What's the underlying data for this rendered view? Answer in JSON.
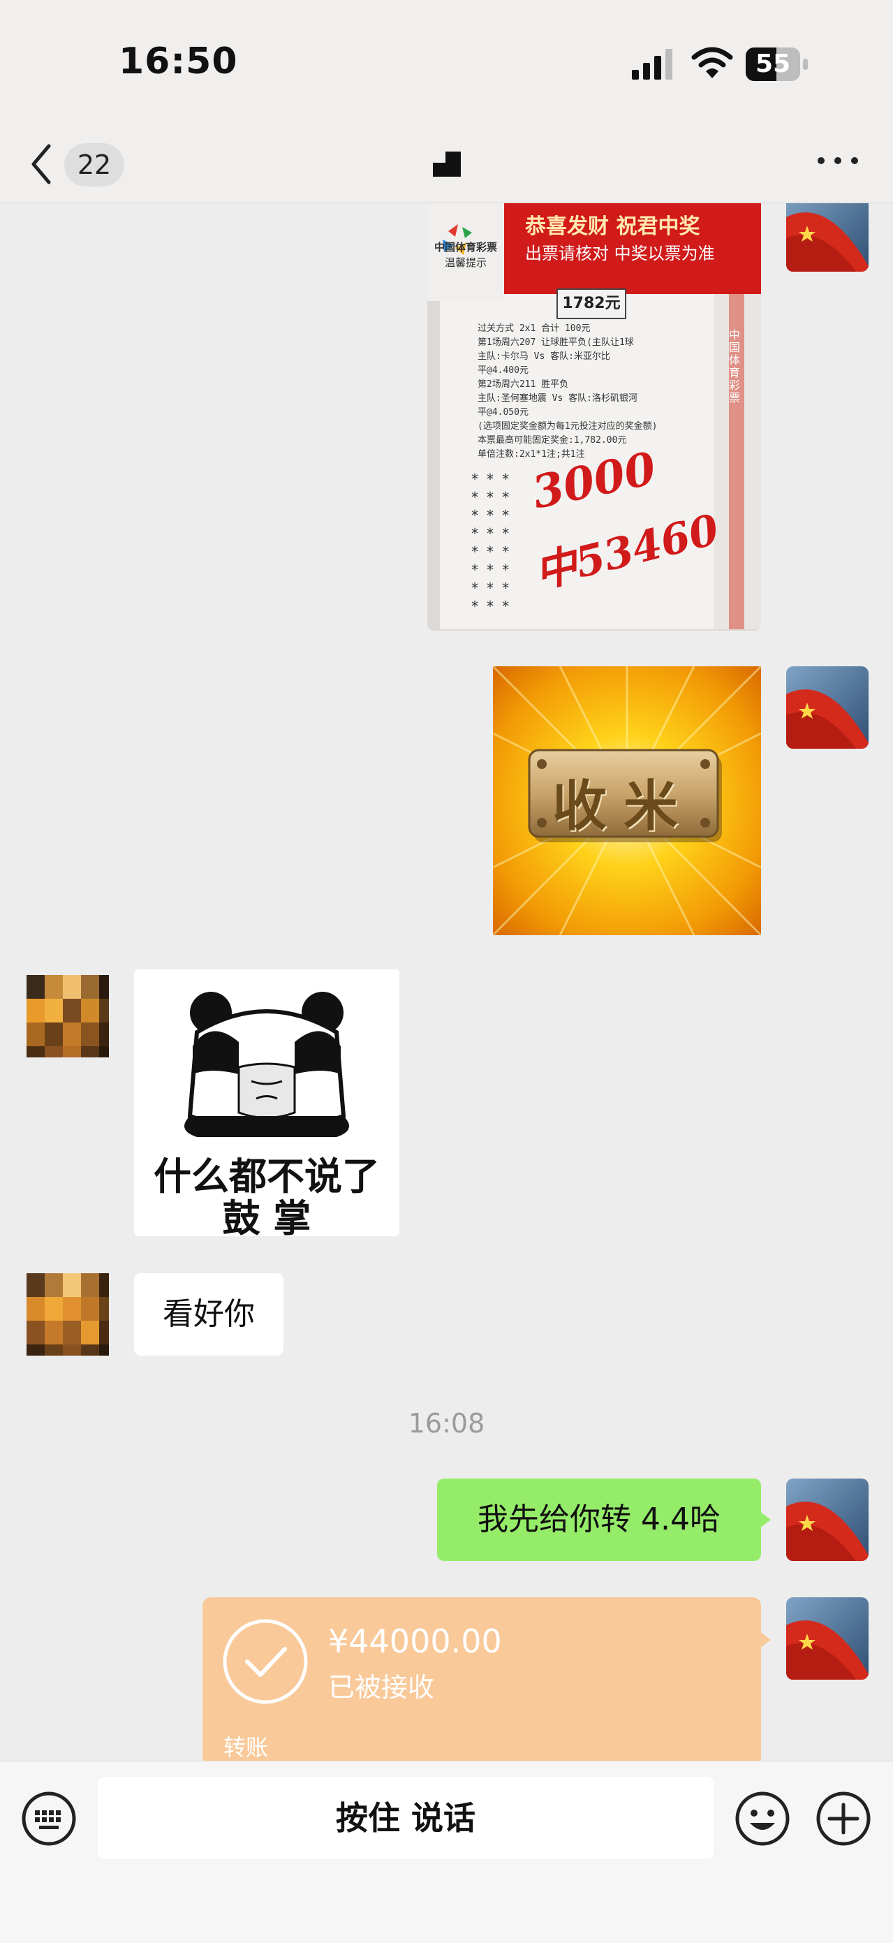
{
  "status_bar": {
    "time": "16:50",
    "battery_level": "55"
  },
  "nav": {
    "unread_count": "22"
  },
  "ticket": {
    "header_line1": "恭喜发财 祝君中奖",
    "header_line2": "出票请核对 中奖以票为准",
    "logo_text": "中国体育彩票",
    "reminder_text": "温馨提示",
    "print_lines": [
      "过关方式 2x1             合计 100元",
      "第1场周六207 让球胜平负(主队让1球",
      "主队:卡尔马 Vs 客队:米亚尔比",
      "平@4.400元",
      "第2场周六211 胜平负",
      "主队:圣何塞地震 Vs 客队:洛杉矶银河",
      "平@4.050元",
      "(选项固定奖金额为每1元投注对应的奖金额)",
      "本票最高可能固定奖金:1,782.00元",
      "单倍注数:2x1*1注;共1注"
    ],
    "stamp_text": "1782元",
    "handwriting_line1": "3000",
    "handwriting_line2": "中53460",
    "side_text": "中国体育彩票"
  },
  "shoukuan_sticker": {
    "plaque_text": "收米"
  },
  "panda_sticker": {
    "line1": "什么都不说了",
    "line2": "鼓 掌"
  },
  "messages": {
    "kanhaoni": "看好你",
    "timestamp": "16:08",
    "transfer_text": "我先给你转 4.4哈"
  },
  "transfer": {
    "amount": "¥44000.00",
    "status": "已被接收",
    "label": "转账"
  },
  "input_bar": {
    "voice_label": "按住 说话"
  },
  "colors": {
    "chat_bg": "#ededed",
    "green_bubble": "#95ec69",
    "transfer_card": "#f9c999",
    "ticket_red": "#d11a1a"
  }
}
